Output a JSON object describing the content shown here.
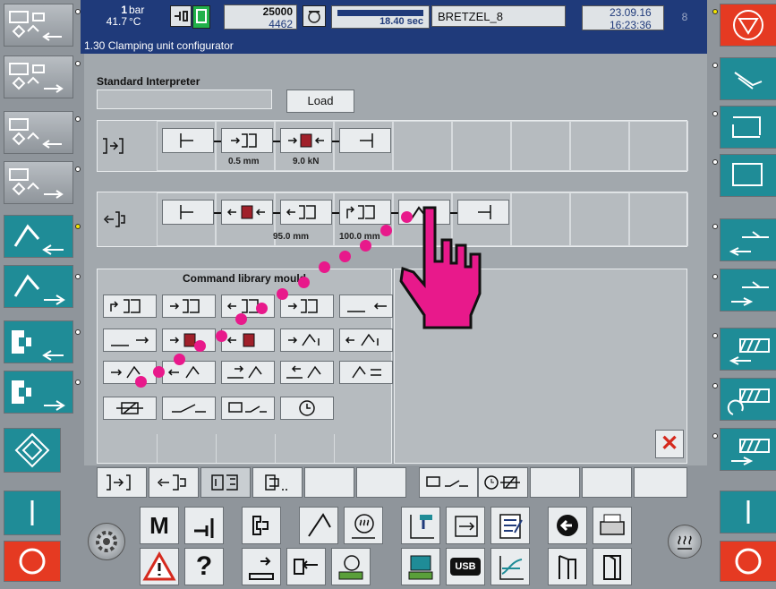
{
  "status": {
    "bar_value": "1",
    "bar_unit": "bar",
    "temp_value": "41.7",
    "temp_unit": "°C",
    "count_top": "25000",
    "count_bottom": "4462",
    "cycle_time": "18.40 sec",
    "mold_name": "BRETZEL_8",
    "date": "23.09.16",
    "time": "16:23:36",
    "page_number": "8"
  },
  "title": "1.30 Clamping unit configurator",
  "interpreter": {
    "label": "Standard Interpreter",
    "input_value": "",
    "load_label": "Load"
  },
  "sequences": {
    "close": {
      "values": [
        "0.5 mm",
        "9.0 kN"
      ]
    },
    "open": {
      "values": [
        "95.0 mm",
        "100.0 mm"
      ]
    }
  },
  "library": {
    "title": "Command library mould"
  },
  "colors": {
    "header_blue": "#1f3a7a",
    "teal": "#1f8c97",
    "alarm_red": "#e53a22",
    "pointer_pink": "#e8198b"
  },
  "icons": {
    "top_left": [
      "clamp-close-icon",
      "mold-clamp-icon"
    ],
    "bottom": [
      "settings-gear-icon",
      "manual-mode-icon",
      "tools-icon",
      "mold-icon",
      "injection-icon",
      "temperature-icon",
      "graph-icon",
      "sequence-icon",
      "notepad-icon",
      "back-arrow-icon",
      "printer-icon",
      "heating-icon",
      "warning-icon",
      "help-icon",
      "ejector-icon",
      "core-pull-icon",
      "mold-height-icon",
      "robot-icon",
      "usb-icon",
      "process-graph-icon",
      "door-open-icon",
      "door-close-icon"
    ]
  }
}
